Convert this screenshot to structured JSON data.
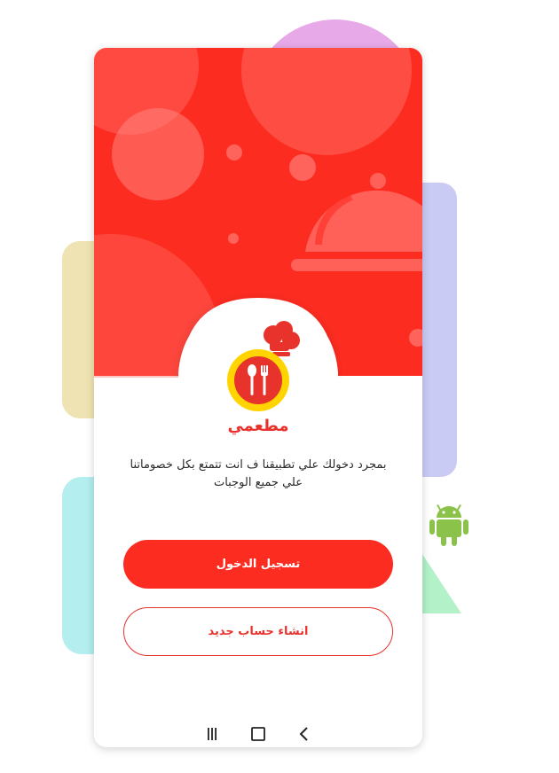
{
  "app": {
    "brand_name": "مطعمي",
    "tagline": "بمجرد دخولك علي تطبيقنا ف انت تتمتع بكل خصوماتنا علي جميع الوجبات"
  },
  "actions": {
    "login_label": "تسجيل الدخول",
    "signup_label": "انشاء حساب جديد"
  },
  "colors": {
    "primary": "#fd2c21",
    "accent": "#ffd400",
    "android": "#8bc34a"
  },
  "navigation": {
    "items": [
      "recent-apps-icon",
      "home-icon",
      "back-icon"
    ]
  }
}
